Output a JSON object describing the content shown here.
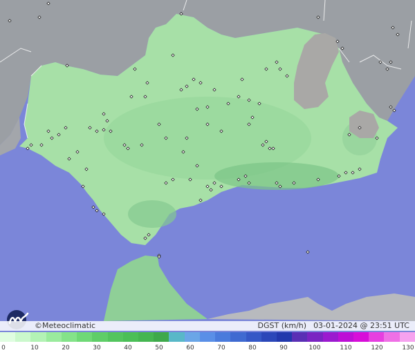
{
  "credit": "©Meteoclimatic",
  "variable": "DGST (km/h)",
  "timestamp": "03-01-2024 @ 23:51 UTC",
  "colors": {
    "sea": "#7b86d9",
    "neighbor_land": "#9b9fa4",
    "region": "#a7e0a7",
    "mountains": "#a9a8a6"
  },
  "scale": {
    "ticks": [
      "0",
      "10",
      "20",
      "30",
      "40",
      "50",
      "60",
      "70",
      "80",
      "90",
      "100",
      "110",
      "120",
      "130"
    ],
    "colors": [
      "#dffde0",
      "#cbf8cc",
      "#b3f2b5",
      "#9aeb9d",
      "#84e389",
      "#6fd976",
      "#5fce68",
      "#53c55e",
      "#4bbf57",
      "#45b651",
      "#3ea94b",
      "#58b8c8",
      "#6aa6e7",
      "#5a8fe7",
      "#4a7bdc",
      "#3f6ad1",
      "#3558c6",
      "#2b47b9",
      "#2238ac",
      "#5a2fb5",
      "#7a24c2",
      "#9b1acf",
      "#bd0fd6",
      "#d70ed9",
      "#e63fe0",
      "#ef70e6",
      "#f6a2ef"
    ]
  }
}
